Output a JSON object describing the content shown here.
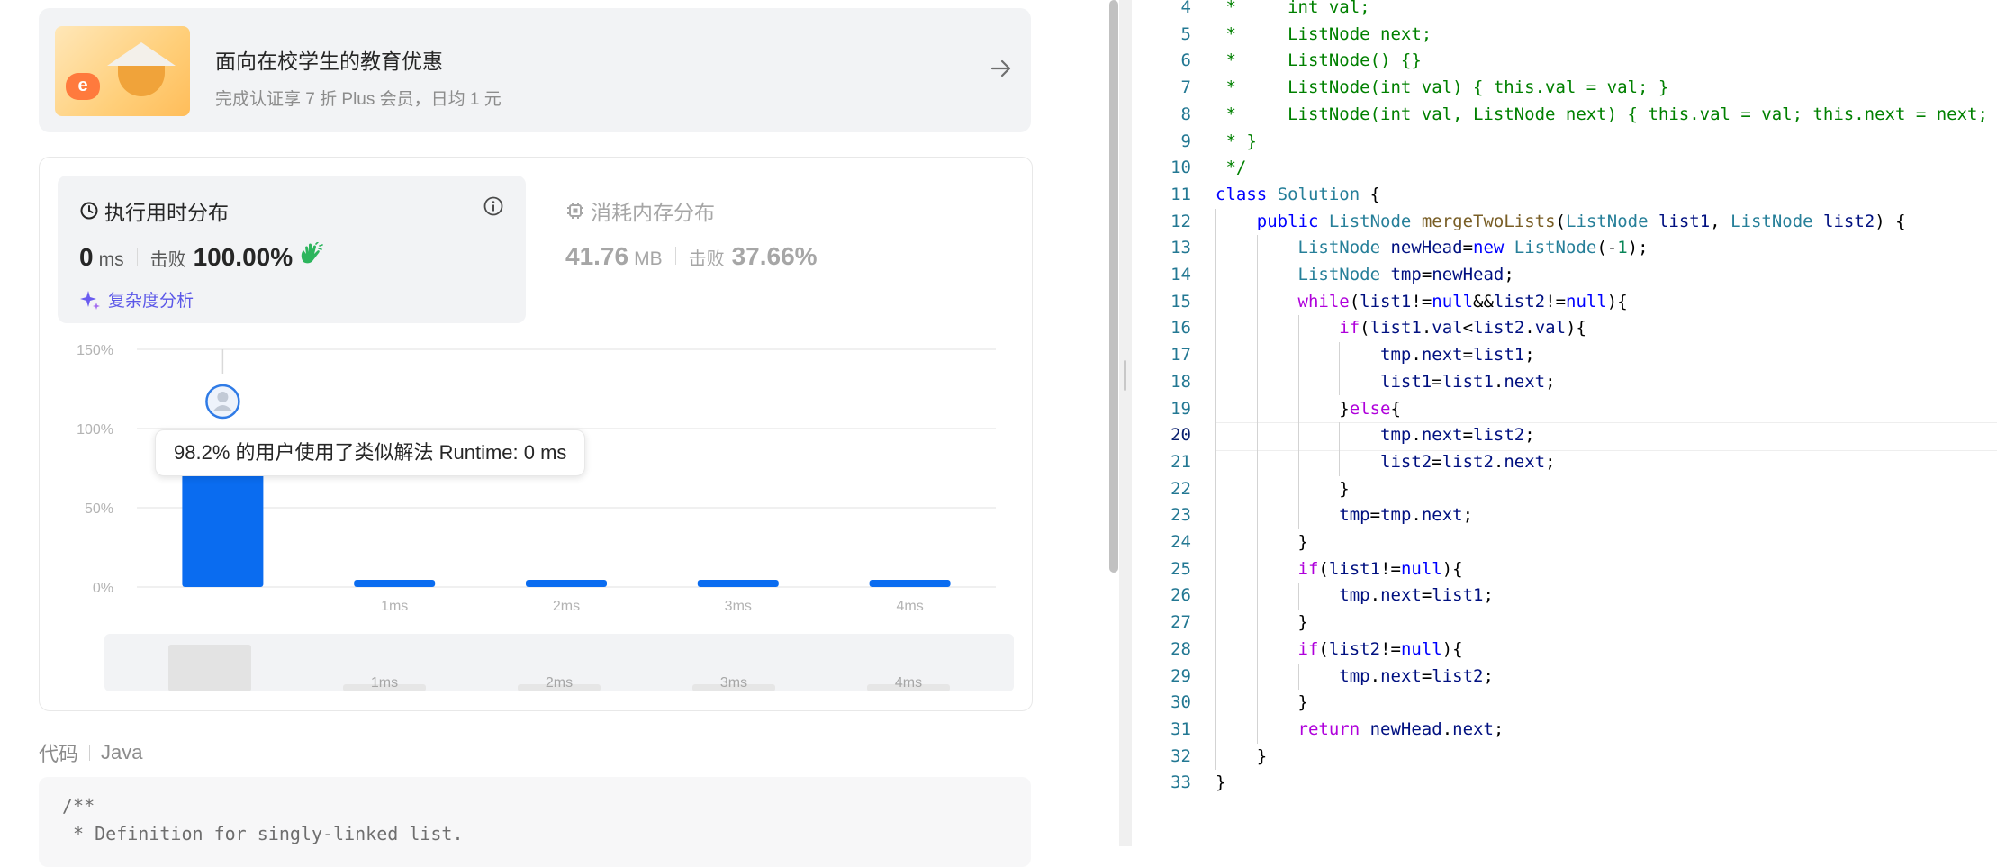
{
  "promo": {
    "title": "面向在校学生的教育优惠",
    "subtitle": "完成认证享 7 折 Plus 会员，日均 1 元",
    "image_badge": "e"
  },
  "runtime": {
    "header": "执行用时分布",
    "value": "0",
    "unit": "ms",
    "beat_label": "击败",
    "beat_pct": "100.00%",
    "complexity_link": "复杂度分析"
  },
  "memory": {
    "header": "消耗内存分布",
    "value": "41.76",
    "unit": "MB",
    "beat_label": "击败",
    "beat_pct": "37.66%"
  },
  "chart_data": {
    "type": "bar",
    "categories": [
      "0ms",
      "1ms",
      "2ms",
      "3ms",
      "4ms"
    ],
    "x_tick_labels": [
      "",
      "1ms",
      "2ms",
      "3ms",
      "4ms"
    ],
    "values": [
      98.2,
      0.5,
      0.5,
      0.5,
      0.5
    ],
    "y_ticks": [
      "0%",
      "50%",
      "100%",
      "150%"
    ],
    "ylim": [
      0,
      150
    ],
    "highlight_index": 0,
    "bar_color": "#0a6cf0",
    "tooltip": "98.2% 的用户使用了类似解法 Runtime: 0 ms",
    "mini_labels": [
      "1ms",
      "2ms",
      "3ms",
      "4ms"
    ]
  },
  "code_section": {
    "label": "代码",
    "language": "Java",
    "preview_lines": [
      "/**",
      " * Definition for singly-linked list."
    ]
  },
  "editor": {
    "active_line": 20,
    "lines": [
      {
        "n": "4",
        "t": " *     int val;"
      },
      {
        "n": "5",
        "t": " *     ListNode next;"
      },
      {
        "n": "6",
        "t": " *     ListNode() {}"
      },
      {
        "n": "7",
        "t": " *     ListNode(int val) { this.val = val; }"
      },
      {
        "n": "8",
        "t": " *     ListNode(int val, ListNode next) { this.val = val; this.next = next; }"
      },
      {
        "n": "9",
        "t": " * }"
      },
      {
        "n": "10",
        "t": " */"
      },
      {
        "n": "11",
        "t": "class Solution {"
      },
      {
        "n": "12",
        "t": "    public ListNode mergeTwoLists(ListNode list1, ListNode list2) {"
      },
      {
        "n": "13",
        "t": "        ListNode newHead=new ListNode(-1);"
      },
      {
        "n": "14",
        "t": "        ListNode tmp=newHead;"
      },
      {
        "n": "15",
        "t": "        while(list1!=null&&list2!=null){"
      },
      {
        "n": "16",
        "t": "            if(list1.val<list2.val){"
      },
      {
        "n": "17",
        "t": "                tmp.next=list1;"
      },
      {
        "n": "18",
        "t": "                list1=list1.next;"
      },
      {
        "n": "19",
        "t": "            }else{"
      },
      {
        "n": "20",
        "t": "                tmp.next=list2;"
      },
      {
        "n": "21",
        "t": "                list2=list2.next;"
      },
      {
        "n": "22",
        "t": "            }"
      },
      {
        "n": "23",
        "t": "            tmp=tmp.next;"
      },
      {
        "n": "24",
        "t": "        }"
      },
      {
        "n": "25",
        "t": "        if(list1!=null){"
      },
      {
        "n": "26",
        "t": "            tmp.next=list1;"
      },
      {
        "n": "27",
        "t": "        }"
      },
      {
        "n": "28",
        "t": "        if(list2!=null){"
      },
      {
        "n": "29",
        "t": "            tmp.next=list2;"
      },
      {
        "n": "30",
        "t": "        }"
      },
      {
        "n": "31",
        "t": "        return newHead.next;"
      },
      {
        "n": "32",
        "t": "    }"
      },
      {
        "n": "33",
        "t": "}"
      }
    ]
  },
  "colors": {
    "accent": "#0a6cf0",
    "link": "#5b57e8",
    "success_icon": "#2db55d"
  },
  "icons": {
    "clock": "clock-icon",
    "info": "info-icon",
    "chip": "chip-icon",
    "sparkle": "sparkle-icon",
    "clap": "clap-icon",
    "arrow": "arrow-right-icon",
    "avatar": "avatar-icon"
  }
}
